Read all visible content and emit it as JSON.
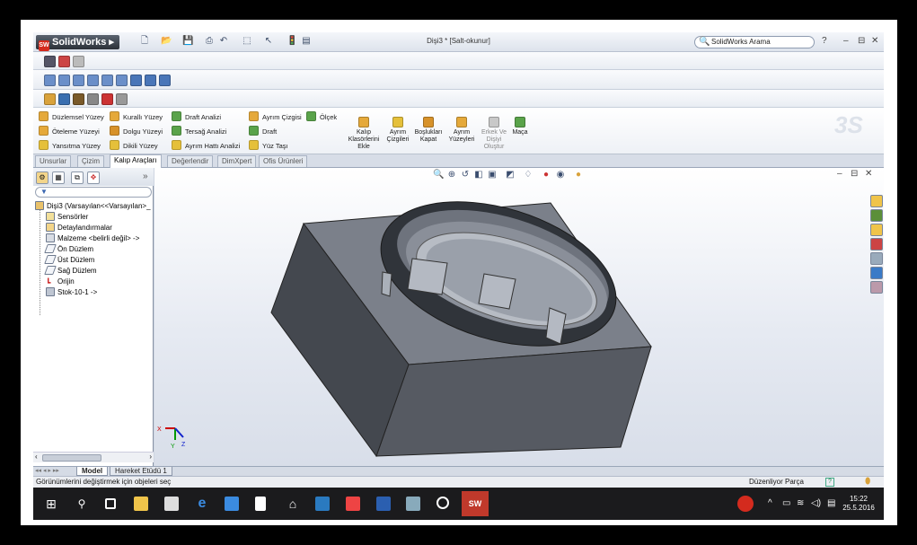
{
  "app": {
    "logo_text": "SolidWorks",
    "logo_mark": "SW",
    "document_title": "Dişi3 * [Salt-okunur]",
    "search_placeholder": "SolidWorks Arama",
    "help_glyph": "?",
    "minimize_glyph": "–",
    "restore_glyph": "⊟",
    "close_glyph": "✕"
  },
  "command_manager": {
    "left_tools": [
      "Düzlemsel Yüzey",
      "Öteleme Yüzeyi",
      "Yansıtma Yüzey"
    ],
    "mid_tools": [
      "Kurallı Yüzey",
      "Dolgu Yüzeyi",
      "Dikili Yüzey"
    ],
    "analysis_tools": [
      "Draft Analizi",
      "Tersağ Analizi",
      "Ayrım Hattı Analizi"
    ],
    "parting_tools": [
      "Ayrım Çizgisi",
      "Draft",
      "Yüz Taşı"
    ],
    "scale_tool": "Ölçek",
    "big_tools": [
      {
        "label": "Kalıp Klasörlerini Ekle",
        "disabled": false
      },
      {
        "label": "Ayrım Çizgileri",
        "disabled": false
      },
      {
        "label": "Boşlukları Kapat",
        "disabled": false
      },
      {
        "label": "Ayrım Yüzeyleri",
        "disabled": false
      },
      {
        "label": "Erkek Ve Dişiyi Oluştur",
        "disabled": true
      },
      {
        "label": "Maça",
        "disabled": false
      }
    ],
    "tabs": [
      "Unsurlar",
      "Çizim",
      "Kalıp Araçları",
      "Değerlendir",
      "DimXpert",
      "Ofis Ürünleri"
    ],
    "active_tab": "Kalıp Araçları"
  },
  "feature_tree": {
    "root": "Dişi3  (Varsayılan<<Varsayılan>_",
    "items": [
      "Sensörler",
      "Detaylandırmalar",
      "Malzeme <belirli değil> ->",
      "Ön Düzlem",
      "Üst Düzlem",
      "Sağ Düzlem",
      "Orijin",
      "Stok-10-1 ->"
    ],
    "filter_glyph": "▼",
    "expand_glyph": "»"
  },
  "viewport": {
    "minimize_glyph": "–",
    "restore_glyph": "⊟",
    "close_glyph": "✕",
    "triad_x": "X",
    "triad_y": "Y",
    "triad_z": "Z"
  },
  "bottom_tabs": [
    "Model",
    "Hareket Etüdü 1"
  ],
  "status": {
    "hint": "Görünümlerini değiştirmek için objeleri seç",
    "mode": "Düzenliyor Parça",
    "help_glyph": "?"
  },
  "taskbar": {
    "time": "15:22",
    "date": "25.5.2016"
  },
  "colors": {
    "accent": "#2b64b6",
    "part_top": "#7a7f89",
    "part_front": "#53575f",
    "part_side": "#3f434a",
    "taskbar": "#1b1b1d",
    "solidworks_red": "#d42b1e"
  }
}
